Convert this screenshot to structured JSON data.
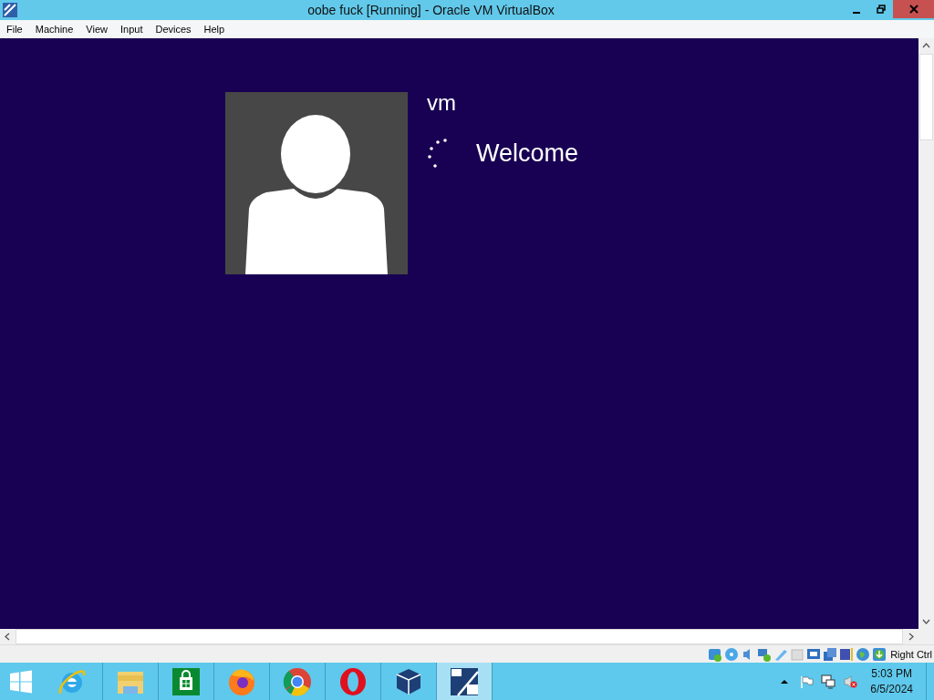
{
  "window": {
    "title": "oobe fuck [Running] - Oracle VM VirtualBox"
  },
  "menu": [
    "File",
    "Machine",
    "View",
    "Input",
    "Devices",
    "Help"
  ],
  "guest_screen": {
    "user_name": "vm",
    "status": "Welcome"
  },
  "status_bar": {
    "host_key": "Right Ctrl"
  },
  "taskbar": {
    "apps": [
      {
        "kind": "ie",
        "selected": false
      },
      {
        "kind": "explorer",
        "selected": false
      },
      {
        "kind": "store",
        "selected": false
      },
      {
        "kind": "firefox",
        "selected": false
      },
      {
        "kind": "chrome",
        "selected": false
      },
      {
        "kind": "opera",
        "selected": false
      },
      {
        "kind": "virtualbox",
        "selected": false
      },
      {
        "kind": "vm",
        "selected": true
      }
    ],
    "clock": {
      "time": "5:03 PM",
      "date": "6/5/2024"
    }
  }
}
